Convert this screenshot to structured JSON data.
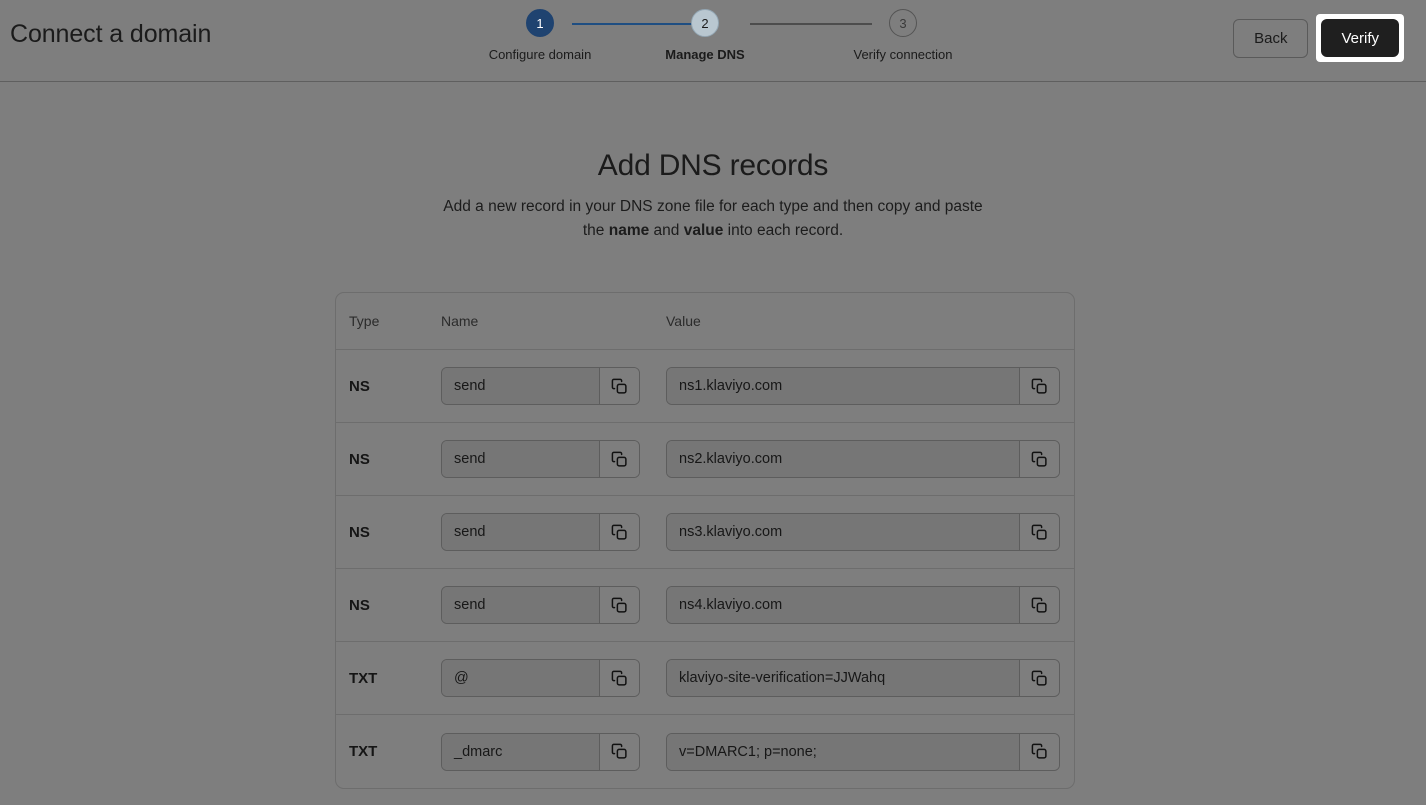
{
  "header": {
    "title": "Connect a domain",
    "back_label": "Back",
    "verify_label": "Verify"
  },
  "stepper": {
    "steps": [
      {
        "number": "1",
        "label": "Configure domain",
        "state": "done"
      },
      {
        "number": "2",
        "label": "Manage DNS",
        "state": "current"
      },
      {
        "number": "3",
        "label": "Verify connection",
        "state": "todo"
      }
    ],
    "active_color": "#1f4370",
    "connector_active_color": "#1f4e82",
    "connector_inactive_color": "#4d4d4d"
  },
  "main": {
    "title": "Add DNS records",
    "subtitle_part1": "Add a new record in your DNS zone file for each type and then copy and paste the ",
    "subtitle_bold1": "name",
    "subtitle_part2": " and ",
    "subtitle_bold2": "value",
    "subtitle_part3": " into each record."
  },
  "table": {
    "columns": [
      "Type",
      "Name",
      "Value"
    ],
    "rows": [
      {
        "type": "NS",
        "name": "send",
        "value": "ns1.klaviyo.com"
      },
      {
        "type": "NS",
        "name": "send",
        "value": "ns2.klaviyo.com"
      },
      {
        "type": "NS",
        "name": "send",
        "value": "ns3.klaviyo.com"
      },
      {
        "type": "NS",
        "name": "send",
        "value": "ns4.klaviyo.com"
      },
      {
        "type": "TXT",
        "name": "@",
        "value": "klaviyo-site-verification=JJWahq"
      },
      {
        "type": "TXT",
        "name": "_dmarc",
        "value": "v=DMARC1; p=none;"
      }
    ]
  },
  "icons": {
    "copy": "copy-icon"
  }
}
